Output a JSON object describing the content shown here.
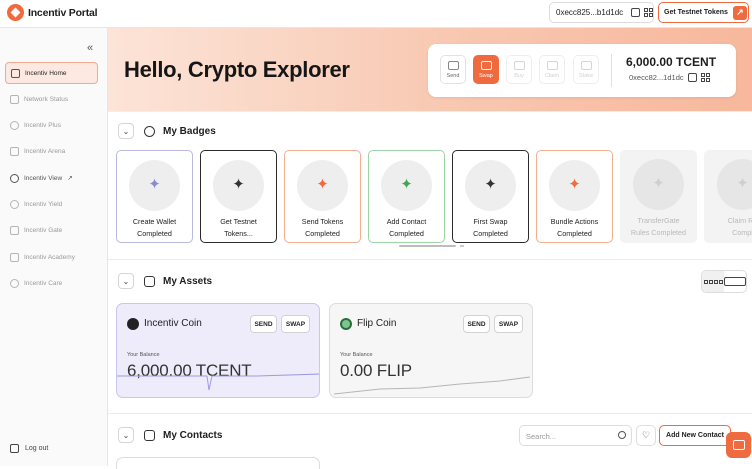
{
  "brand": {
    "name": "Incentiv Portal"
  },
  "topbar": {
    "wallet_address": "0xecc825...b1d1dc",
    "testnet_button": "Get Testnet Tokens",
    "arrow_glyph": "↗"
  },
  "sidebar": {
    "collapse_glyph": "«",
    "items": [
      {
        "label": "Incentiv Home",
        "icon": "home-icon"
      },
      {
        "label": "Network Status",
        "icon": "status-icon"
      },
      {
        "label": "Incentiv Plus",
        "icon": "plus-icon"
      },
      {
        "label": "Incentiv Arena",
        "icon": "arena-icon"
      },
      {
        "label": "Incentiv View",
        "icon": "view-icon"
      },
      {
        "label": "Incentiv Yield",
        "icon": "yield-icon"
      },
      {
        "label": "Incentiv Gate",
        "icon": "gate-icon"
      },
      {
        "label": "Incentiv Academy",
        "icon": "academy-icon"
      },
      {
        "label": "Incentiv Care",
        "icon": "care-icon"
      }
    ],
    "external_glyph": "↗",
    "logout": "Log out"
  },
  "hero": {
    "greeting": "Hello, Crypto Explorer",
    "actions": [
      "Send",
      "Swap",
      "Buy",
      "Claim",
      "Stake"
    ],
    "balance": "6,000.00 TCENT",
    "address": "0xecc82...1d1dc"
  },
  "badges": {
    "title": "My Badges",
    "items": [
      {
        "line1": "Create Wallet",
        "line2": "Completed",
        "style": "purple"
      },
      {
        "line1": "Get Testnet",
        "line2": "Tokens...",
        "style": "dark"
      },
      {
        "line1": "Send Tokens",
        "line2": "Completed",
        "style": "orange"
      },
      {
        "line1": "Add Contact",
        "line2": "Completed",
        "style": "green"
      },
      {
        "line1": "First Swap",
        "line2": "Completed",
        "style": "dark"
      },
      {
        "line1": "Bundle Actions",
        "line2": "Completed",
        "style": "orange"
      },
      {
        "line1": "TransferGate",
        "line2": "Rules Completed",
        "style": "ghost"
      },
      {
        "line1": "Claim Re",
        "line2": "Compl",
        "style": "ghost"
      }
    ]
  },
  "assets": {
    "title": "My Assets",
    "send_label": "SEND",
    "swap_label": "SWAP",
    "your_balance_label": "Your Balance",
    "items": [
      {
        "name": "Incentiv Coin",
        "amount": "6,000.00 TCENT"
      },
      {
        "name": "Flip Coin",
        "amount": "0.00 FLIP"
      }
    ]
  },
  "contacts": {
    "title": "My Contacts",
    "search_placeholder": "Search...",
    "heart_glyph": "♡",
    "add_button": "Add New Contact"
  },
  "colors": {
    "accent": "#ef6a3e",
    "hero_start": "#fce4d8",
    "hero_end": "#f7b89d"
  }
}
